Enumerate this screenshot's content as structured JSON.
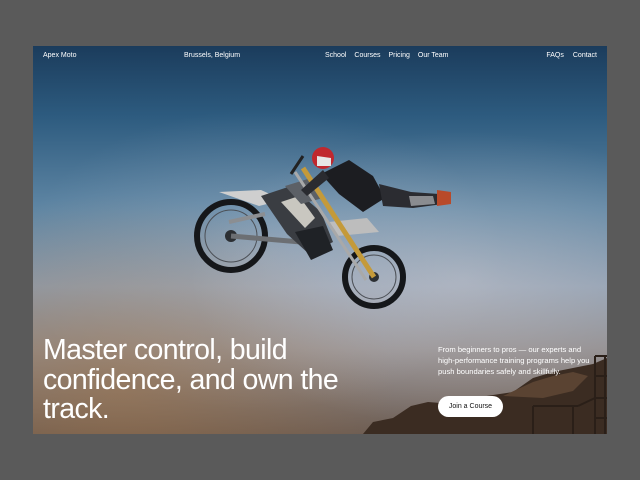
{
  "nav": {
    "brand": "Apex Moto",
    "location": "Brussels, Belgium",
    "menu": [
      "School",
      "Courses",
      "Pricing",
      "Our Team"
    ],
    "right": [
      "FAQs",
      "Contact"
    ]
  },
  "hero": {
    "headline": "Master control, build confidence, and own the track.",
    "description": "From beginners to pros — our experts and high-performance training programs help you push boundaries safely and skillfully.",
    "cta_label": "Join a Course",
    "image_subject": "motocross rider performing a mid-air jump",
    "colors": {
      "sky_top": "#1b3c5c",
      "sky_mid": "#5f86a4",
      "horizon": "#8d9db0",
      "ground": "#6d5d53",
      "cta_background": "#ffffff",
      "text": "#ffffff",
      "helmet": "#c0282e"
    }
  }
}
